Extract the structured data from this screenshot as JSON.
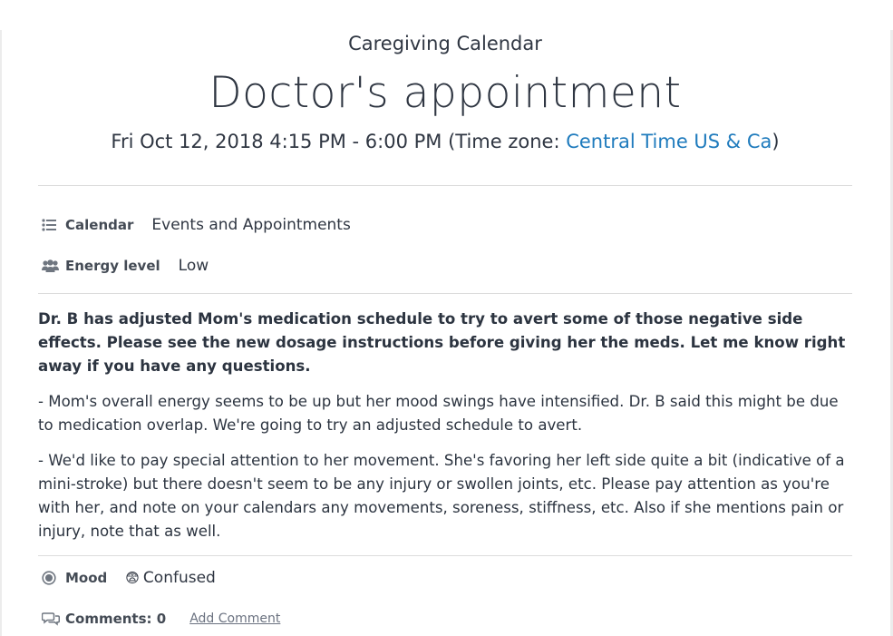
{
  "header": {
    "calendar_title": "Caregiving Calendar",
    "event_title": "Doctor's appointment",
    "time_prefix": "Fri Oct 12, 2018 4:15 PM - 6:00 PM (Time zone: ",
    "timezone_link": "Central Time US & Ca",
    "time_suffix": ")"
  },
  "details": {
    "calendar_label": "Calendar",
    "calendar_value": "Events and Appointments",
    "energy_label": "Energy level",
    "energy_value": "Low"
  },
  "notes": {
    "bold": "Dr. B has adjusted Mom's medication schedule to try to avert some of those negative side effects. Please see the new dosage instructions before giving her the meds. Let me know right away if you have any questions.",
    "paragraph1": "- Mom's overall energy seems to be up but her mood swings have intensified. Dr. B said this might be due to medication overlap. We're going to try an adjusted schedule to avert.",
    "paragraph2": "- We'd like to pay special attention to her movement. She's favoring her left side quite a bit (indicative of a mini-stroke) but there doesn't seem to be any injury or swollen joints, etc. Please pay attention as you're with her, and note on your calendars any movements, soreness, stiffness, etc. Also if she mentions pain or injury, note that as well."
  },
  "footer": {
    "mood_label": "Mood",
    "mood_emoji": "😨",
    "mood_value": "Confused",
    "comments_label": "Comments: 0",
    "add_comment": "Add Comment"
  },
  "icons": {
    "calendar": "list-icon",
    "energy": "users-icon",
    "mood": "radio-icon",
    "comments": "comments-icon"
  },
  "colors": {
    "link": "#1f7bbd",
    "text": "#2c3440",
    "muted": "#6b7280",
    "divider": "#dcdcdc"
  }
}
